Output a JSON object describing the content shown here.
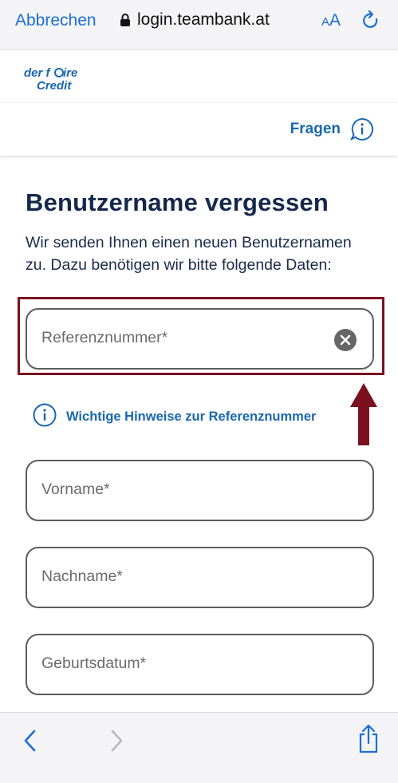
{
  "browser": {
    "cancel_label": "Abbrechen",
    "url": "login.teambank.at",
    "text_size_label_small": "A",
    "text_size_label_large": "A"
  },
  "site": {
    "logo_text": "der faire Credit",
    "help_label": "Fragen"
  },
  "main": {
    "title": "Benutzername vergessen",
    "intro": "Wir senden Ihnen einen neuen Benutzernamen zu. Dazu benötigen wir bitte folgende Daten:",
    "reference_hint": "Wichtige Hinweise zur Referenznummer",
    "fields": {
      "reference_placeholder": "Referenznummer*",
      "firstname_placeholder": "Vorname*",
      "lastname_placeholder": "Nachname*",
      "birthdate_placeholder": "Geburtsdatum*"
    }
  },
  "colors": {
    "accent": "#1a67b0",
    "browser_blue": "#1a6fd3",
    "title": "#14284b",
    "annotation": "#7a1021"
  },
  "icons": {
    "lock": "lock-icon",
    "reload": "reload-icon",
    "info": "info-icon",
    "clear": "clear-icon",
    "back": "chevron-left-icon",
    "forward": "chevron-right-icon",
    "share": "share-icon",
    "annotation": "arrow-up-icon"
  }
}
